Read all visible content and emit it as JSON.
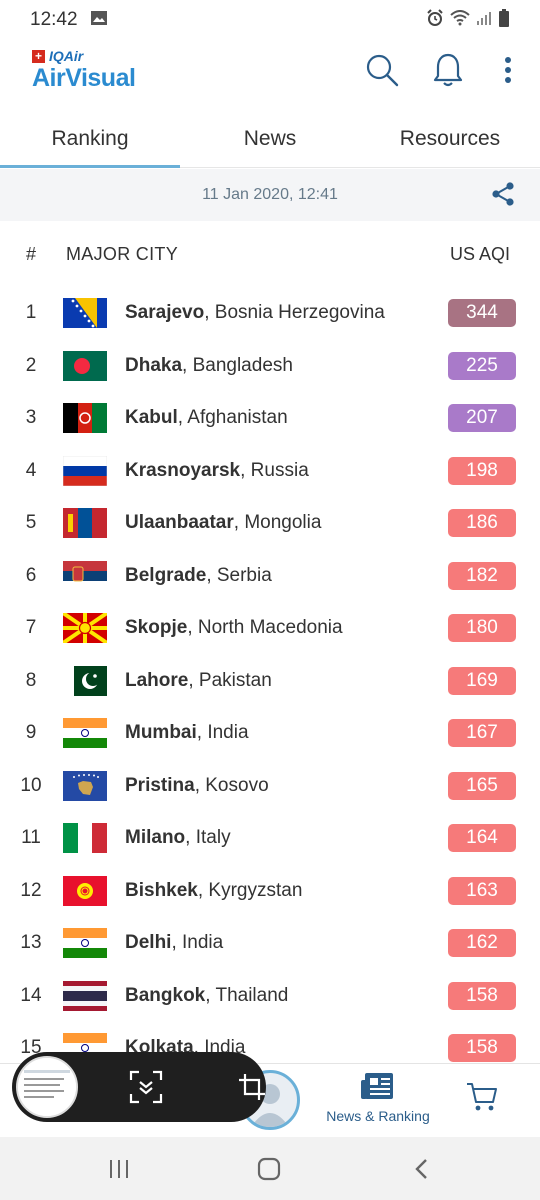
{
  "status_bar": {
    "time": "12:42"
  },
  "app": {
    "brand_top": "IQAir",
    "brand_name": "AirVisual"
  },
  "tabs": [
    {
      "label": "Ranking",
      "active": true
    },
    {
      "label": "News",
      "active": false
    },
    {
      "label": "Resources",
      "active": false
    }
  ],
  "date_bar": {
    "timestamp": "11 Jan 2020, 12:41"
  },
  "table": {
    "col_rank": "#",
    "col_city": "MAJOR CITY",
    "col_aqi": "US AQI"
  },
  "colors": {
    "hazardous": "#a87383",
    "very_unhealthy": "#a97ac9",
    "unhealthy": "#f67a7a",
    "accent": "#2b8bd0"
  },
  "rows": [
    {
      "rank": "1",
      "city": "Sarajevo",
      "country": ", Bosnia Herzegovina",
      "aqi": "344",
      "level": "hazardous",
      "flag": "bosnia-flag"
    },
    {
      "rank": "2",
      "city": "Dhaka",
      "country": ", Bangladesh",
      "aqi": "225",
      "level": "very_unhealthy",
      "flag": "bangladesh-flag"
    },
    {
      "rank": "3",
      "city": "Kabul",
      "country": ", Afghanistan",
      "aqi": "207",
      "level": "very_unhealthy",
      "flag": "afghanistan-flag"
    },
    {
      "rank": "4",
      "city": "Krasnoyarsk",
      "country": ", Russia",
      "aqi": "198",
      "level": "unhealthy",
      "flag": "russia-flag"
    },
    {
      "rank": "5",
      "city": "Ulaanbaatar",
      "country": ", Mongolia",
      "aqi": "186",
      "level": "unhealthy",
      "flag": "mongolia-flag"
    },
    {
      "rank": "6",
      "city": "Belgrade",
      "country": ", Serbia",
      "aqi": "182",
      "level": "unhealthy",
      "flag": "serbia-flag"
    },
    {
      "rank": "7",
      "city": "Skopje",
      "country": ", North Macedonia",
      "aqi": "180",
      "level": "unhealthy",
      "flag": "macedonia-flag"
    },
    {
      "rank": "8",
      "city": "Lahore",
      "country": ", Pakistan",
      "aqi": "169",
      "level": "unhealthy",
      "flag": "pakistan-flag"
    },
    {
      "rank": "9",
      "city": "Mumbai",
      "country": ", India",
      "aqi": "167",
      "level": "unhealthy",
      "flag": "india-flag"
    },
    {
      "rank": "10",
      "city": "Pristina",
      "country": ", Kosovo",
      "aqi": "165",
      "level": "unhealthy",
      "flag": "kosovo-flag"
    },
    {
      "rank": "11",
      "city": "Milano",
      "country": ", Italy",
      "aqi": "164",
      "level": "unhealthy",
      "flag": "italy-flag"
    },
    {
      "rank": "12",
      "city": "Bishkek",
      "country": ", Kyrgyzstan",
      "aqi": "163",
      "level": "unhealthy",
      "flag": "kyrgyzstan-flag"
    },
    {
      "rank": "13",
      "city": "Delhi",
      "country": ", India",
      "aqi": "162",
      "level": "unhealthy",
      "flag": "india-flag"
    },
    {
      "rank": "14",
      "city": "Bangkok",
      "country": ", Thailand",
      "aqi": "158",
      "level": "unhealthy",
      "flag": "thailand-flag"
    },
    {
      "rank": "15",
      "city": "Kolkata",
      "country": ", India",
      "aqi": "158",
      "level": "unhealthy",
      "flag": "india-flag"
    }
  ],
  "bottom_nav": {
    "news_ranking_label": "News & Ranking"
  }
}
